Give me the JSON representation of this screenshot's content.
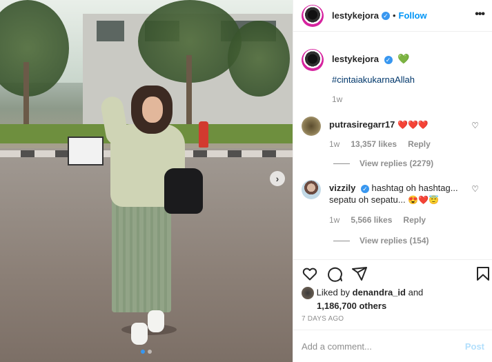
{
  "post": {
    "image_alt": "Woman in hijab and sage green outfit standing on pavement",
    "carousel": {
      "dots": 2,
      "active": 0
    }
  },
  "header": {
    "username": "lestykejora",
    "verified_mark": "✓",
    "separator": "•",
    "follow_label": "Follow",
    "more_label": "•••"
  },
  "caption": {
    "username": "lestykejora",
    "heart": "💚",
    "hashtag": "#cintaiakukarnaAllah",
    "time": "1w"
  },
  "comments": [
    {
      "username": "putrasiregarr17",
      "text": "❤️❤️❤️",
      "time": "1w",
      "likes": "13,357 likes",
      "reply_label": "Reply",
      "view_replies": "View replies (2279)"
    },
    {
      "username": "vizzily",
      "text_line1": "hashtag oh hashtag...",
      "text_line2": "sepatu oh sepatu...",
      "emoji": "😍❤️😇",
      "time": "1w",
      "likes": "5,566 likes",
      "reply_label": "Reply",
      "view_replies": "View replies (154)"
    }
  ],
  "likes": {
    "prefix": "Liked by",
    "user": "denandra_id",
    "and": "and",
    "others": "1,186,700 others"
  },
  "timestamp": "7 DAYS AGO",
  "add_comment": {
    "placeholder": "Add a comment...",
    "post_label": "Post"
  },
  "icons": [
    "heart-icon",
    "comment-icon",
    "share-icon",
    "bookmark-icon",
    "chevron-right-icon",
    "more-icon"
  ],
  "colors": {
    "link": "#0095f6",
    "hashtag": "#00376b",
    "muted": "#8e8e8e",
    "post_disabled": "#b2dffc",
    "verified": "#3897f0"
  }
}
